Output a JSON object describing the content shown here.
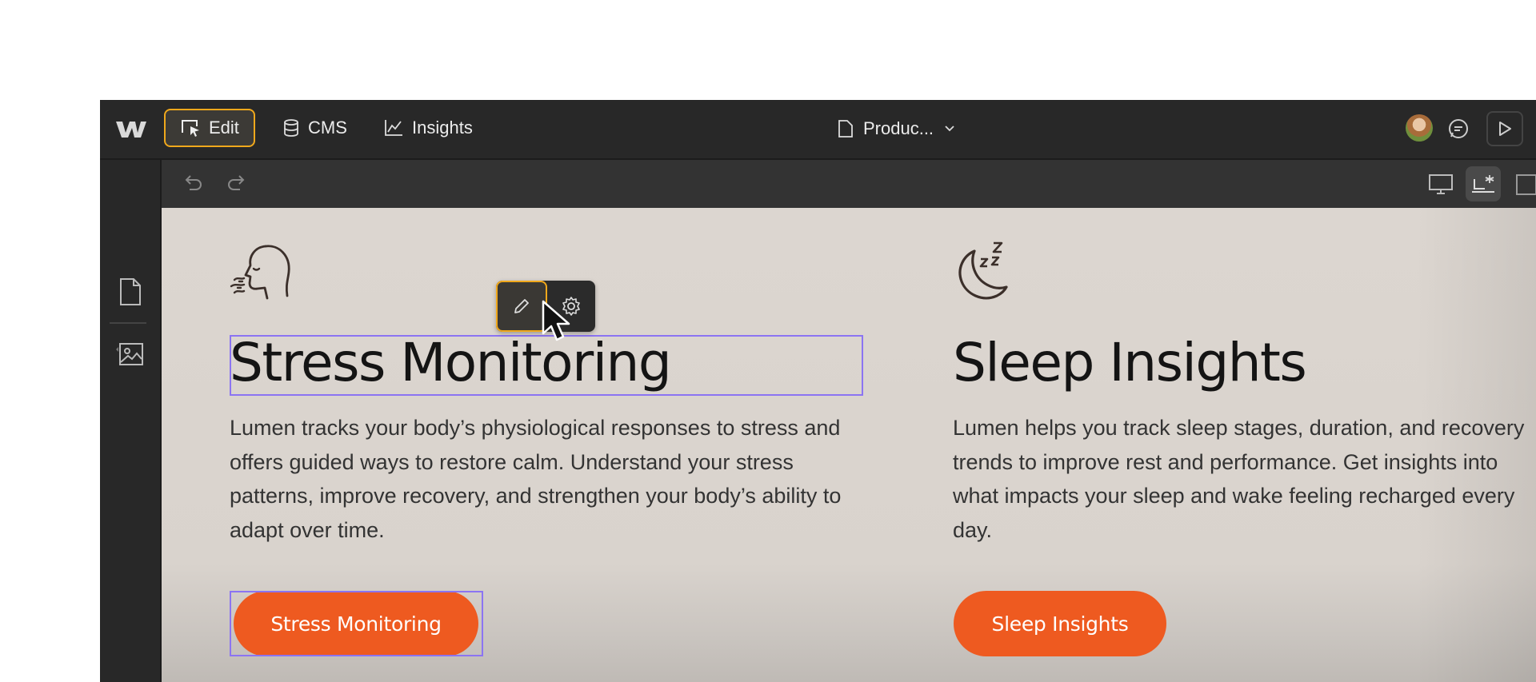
{
  "topbar": {
    "modes": [
      {
        "label": "Edit",
        "icon": "edit-cursor-icon",
        "active": true
      },
      {
        "label": "CMS",
        "icon": "database-icon"
      },
      {
        "label": "Insights",
        "icon": "chart-line-icon"
      }
    ],
    "page_selector": {
      "label": "Produc...",
      "icon": "page-icon"
    },
    "accent_color": "#f0a81c"
  },
  "features": [
    {
      "icon": "breathing-head-icon",
      "title": "Stress Monitoring",
      "text": "Lumen tracks your body’s physiological responses to stress and offers guided ways to restore calm. Understand your stress patterns, improve recovery, and strengthen your body’s ability to adapt over time.",
      "button": "Stress Monitoring"
    },
    {
      "icon": "moon-zzz-icon",
      "title": "Sleep Insights",
      "text": "Lumen helps you track sleep stages, duration, and recovery trends to improve rest and performance. Get insights into what impacts your sleep and wake feeling recharged every day.",
      "button": "Sleep Insights"
    }
  ],
  "colors": {
    "cta": "#ee5a20",
    "selection": "#8b74f2",
    "canvas_bg": "#dcd6d0"
  }
}
